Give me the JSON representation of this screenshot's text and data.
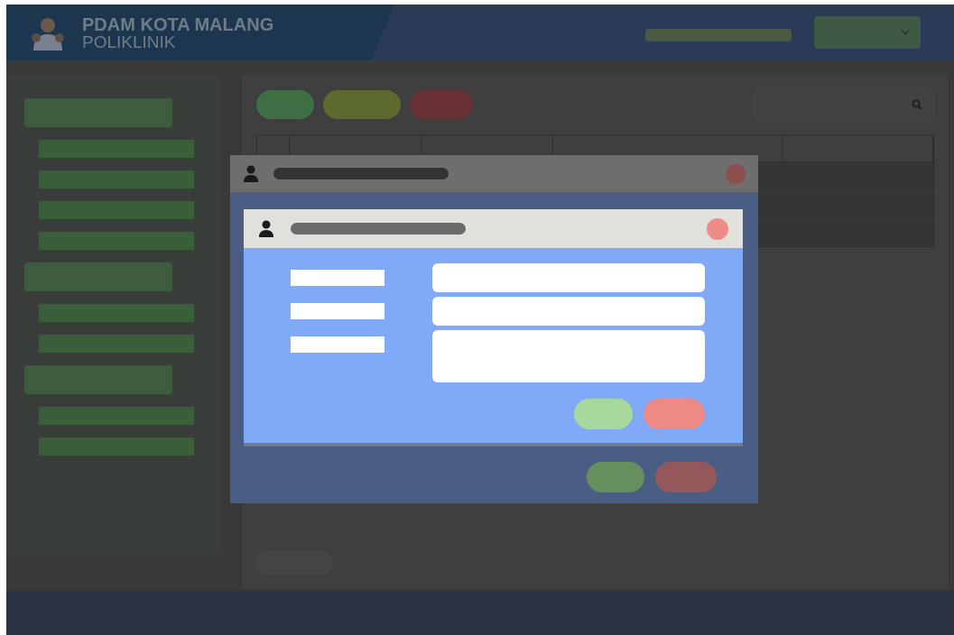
{
  "header": {
    "title": "PDAM KOTA MALANG",
    "subtitle": "POLIKLINIK",
    "user_menu": {
      "kind": "dropdown"
    }
  },
  "sidebar": {
    "groups": [
      {
        "kind": "heading",
        "items": [
          {
            "kind": "bar"
          },
          {
            "kind": "bar"
          },
          {
            "kind": "bar"
          },
          {
            "kind": "bar"
          }
        ]
      },
      {
        "kind": "heading",
        "items": [
          {
            "kind": "bar"
          },
          {
            "kind": "bar"
          }
        ]
      },
      {
        "kind": "heading",
        "items": [
          {
            "kind": "bar"
          },
          {
            "kind": "bar"
          }
        ]
      }
    ]
  },
  "toolbar": {
    "buttons": [
      {
        "color": "#3f6f45"
      },
      {
        "color": "#5d6a2e"
      },
      {
        "color": "#6a3236"
      }
    ]
  },
  "table": {
    "columns": [
      {
        "kind": "narrow"
      },
      {
        "kind": "wide"
      },
      {
        "kind": "wide"
      },
      {
        "kind": "xwide"
      },
      {
        "kind": "fill"
      }
    ],
    "rows": [
      {
        "kind": "row"
      },
      {
        "kind": "row"
      },
      {
        "kind": "row"
      }
    ]
  },
  "outer_dialog": {
    "kind": "user",
    "buttons": [
      {
        "color": "#668f5e"
      },
      {
        "color": "#94585a"
      }
    ]
  },
  "inner_dialog": {
    "kind": "user",
    "fields": [
      {
        "kind": "line"
      },
      {
        "kind": "line"
      },
      {
        "kind": "area"
      }
    ],
    "buttons": [
      {
        "color": "#a6d99b"
      },
      {
        "color": "#ee8b87"
      }
    ]
  }
}
